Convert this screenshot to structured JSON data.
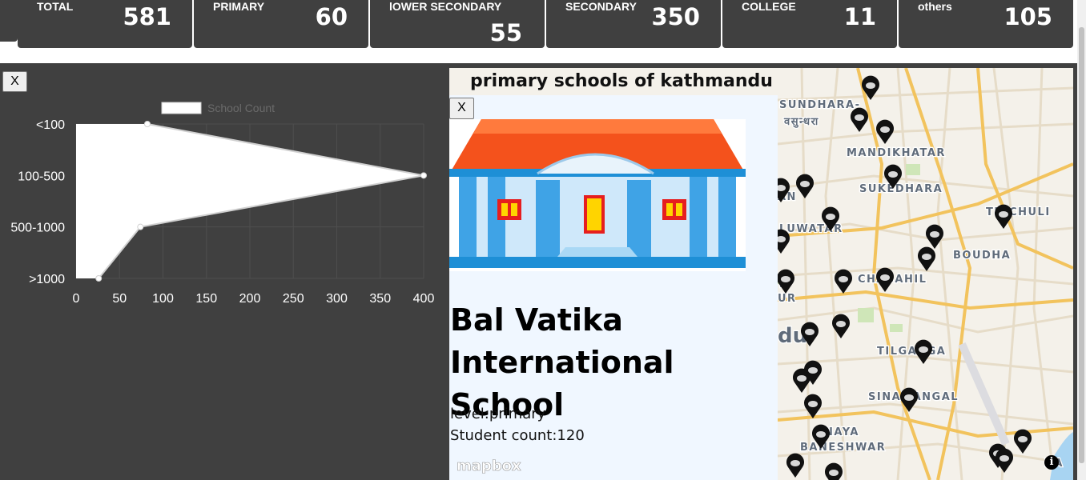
{
  "stats": [
    {
      "label": "TOTAL",
      "value": "581"
    },
    {
      "label": "PRIMARY",
      "value": "60"
    },
    {
      "label": "lOWER SECONDARY",
      "value": "55"
    },
    {
      "label": "SECONDARY",
      "value": "350"
    },
    {
      "label": "COLLEGE",
      "value": "11"
    },
    {
      "label": "others",
      "value": "105"
    }
  ],
  "close_label": "X",
  "chart_data": {
    "type": "line",
    "orientation": "horizontal",
    "categories": [
      "<100",
      "100-500",
      "500-1000",
      ">1000"
    ],
    "series": [
      {
        "name": "School Count",
        "values": [
          82,
          400,
          74,
          26
        ]
      }
    ],
    "xlim": [
      0,
      400
    ],
    "xticks": [
      0,
      50,
      100,
      150,
      200,
      250,
      300,
      350,
      400
    ],
    "fill": true,
    "grid": true,
    "legend": "top-center",
    "colors": {
      "fill": "#ffffff",
      "line": "#d0d0d0",
      "grid": "#4e4e4e",
      "tick": "#ffffff",
      "legend_text": "#6a6a6a"
    }
  },
  "map": {
    "title": "primary schools of kathmandu",
    "popup": {
      "school_image_icon": "school-building-icon",
      "name": "Bal Vatika International School",
      "level": "level:primary",
      "students": "Student count:120"
    },
    "logo": "mapbox",
    "info_icon": "info-icon",
    "place_labels": [
      "SUNDHARA-",
      "वसुन्धरा",
      "MANDIKHATAR",
      "SUKEDHARA",
      "TINCHULI",
      "LUWATAR",
      "BOUDHA",
      "CHABAHIL",
      "TILGANGA",
      "SINAMANGAL",
      "NAYA",
      "BANESHWAR",
      "du",
      "AN",
      "N",
      "UR",
      "NA"
    ],
    "marker_icon": "map-pin-icon"
  }
}
